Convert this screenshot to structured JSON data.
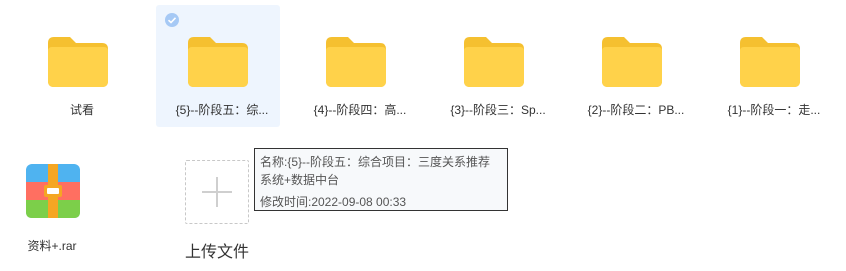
{
  "files": [
    {
      "label": "试看",
      "type": "folder",
      "selected": false
    },
    {
      "label": "{5}--阶段五：综...",
      "type": "folder",
      "selected": true
    },
    {
      "label": "{4}--阶段四：高...",
      "type": "folder",
      "selected": false
    },
    {
      "label": "{3}--阶段三：Sp...",
      "type": "folder",
      "selected": false
    },
    {
      "label": "{2}--阶段二：PB...",
      "type": "folder",
      "selected": false
    },
    {
      "label": "{1}--阶段一：走...",
      "type": "folder",
      "selected": false
    }
  ],
  "archive": {
    "label": "资料+.rar",
    "type": "rar"
  },
  "upload": {
    "label": "上传文件"
  },
  "tooltip": {
    "name_line": "名称:{5}--阶段五：综合项目：三度关系推荐系统+数据中台",
    "time_line": "修改时间:2022-09-08 00:33"
  },
  "colors": {
    "folder": "#ffd24a",
    "folder_back": "#f5c030",
    "selected_bg": "#eef5fe",
    "check": "#a6c9f5"
  }
}
